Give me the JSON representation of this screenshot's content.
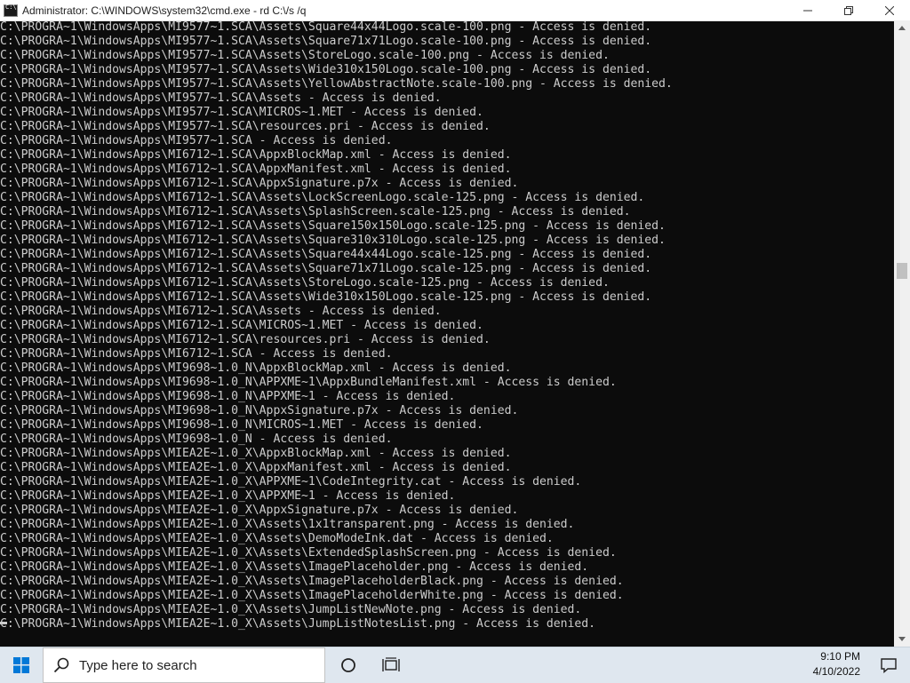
{
  "window": {
    "title": "Administrator: C:\\WINDOWS\\system32\\cmd.exe - rd  C:\\/s /q",
    "controls": {
      "minimize_icon": "minimize-icon",
      "maximize_icon": "restore-icon",
      "close_icon": "close-icon"
    }
  },
  "console": {
    "background": "#0c0c0c",
    "foreground": "#cccccc",
    "lines": [
      "C:\\PROGRA~1\\WindowsApps\\MI9577~1.SCA\\Assets\\Square44x44Logo.scale-100.png - Access is denied.",
      "C:\\PROGRA~1\\WindowsApps\\MI9577~1.SCA\\Assets\\Square71x71Logo.scale-100.png - Access is denied.",
      "C:\\PROGRA~1\\WindowsApps\\MI9577~1.SCA\\Assets\\StoreLogo.scale-100.png - Access is denied.",
      "C:\\PROGRA~1\\WindowsApps\\MI9577~1.SCA\\Assets\\Wide310x150Logo.scale-100.png - Access is denied.",
      "C:\\PROGRA~1\\WindowsApps\\MI9577~1.SCA\\Assets\\YellowAbstractNote.scale-100.png - Access is denied.",
      "C:\\PROGRA~1\\WindowsApps\\MI9577~1.SCA\\Assets - Access is denied.",
      "C:\\PROGRA~1\\WindowsApps\\MI9577~1.SCA\\MICROS~1.MET - Access is denied.",
      "C:\\PROGRA~1\\WindowsApps\\MI9577~1.SCA\\resources.pri - Access is denied.",
      "C:\\PROGRA~1\\WindowsApps\\MI9577~1.SCA - Access is denied.",
      "C:\\PROGRA~1\\WindowsApps\\MI6712~1.SCA\\AppxBlockMap.xml - Access is denied.",
      "C:\\PROGRA~1\\WindowsApps\\MI6712~1.SCA\\AppxManifest.xml - Access is denied.",
      "C:\\PROGRA~1\\WindowsApps\\MI6712~1.SCA\\AppxSignature.p7x - Access is denied.",
      "C:\\PROGRA~1\\WindowsApps\\MI6712~1.SCA\\Assets\\LockScreenLogo.scale-125.png - Access is denied.",
      "C:\\PROGRA~1\\WindowsApps\\MI6712~1.SCA\\Assets\\SplashScreen.scale-125.png - Access is denied.",
      "C:\\PROGRA~1\\WindowsApps\\MI6712~1.SCA\\Assets\\Square150x150Logo.scale-125.png - Access is denied.",
      "C:\\PROGRA~1\\WindowsApps\\MI6712~1.SCA\\Assets\\Square310x310Logo.scale-125.png - Access is denied.",
      "C:\\PROGRA~1\\WindowsApps\\MI6712~1.SCA\\Assets\\Square44x44Logo.scale-125.png - Access is denied.",
      "C:\\PROGRA~1\\WindowsApps\\MI6712~1.SCA\\Assets\\Square71x71Logo.scale-125.png - Access is denied.",
      "C:\\PROGRA~1\\WindowsApps\\MI6712~1.SCA\\Assets\\StoreLogo.scale-125.png - Access is denied.",
      "C:\\PROGRA~1\\WindowsApps\\MI6712~1.SCA\\Assets\\Wide310x150Logo.scale-125.png - Access is denied.",
      "C:\\PROGRA~1\\WindowsApps\\MI6712~1.SCA\\Assets - Access is denied.",
      "C:\\PROGRA~1\\WindowsApps\\MI6712~1.SCA\\MICROS~1.MET - Access is denied.",
      "C:\\PROGRA~1\\WindowsApps\\MI6712~1.SCA\\resources.pri - Access is denied.",
      "C:\\PROGRA~1\\WindowsApps\\MI6712~1.SCA - Access is denied.",
      "C:\\PROGRA~1\\WindowsApps\\MI9698~1.0_N\\AppxBlockMap.xml - Access is denied.",
      "C:\\PROGRA~1\\WindowsApps\\MI9698~1.0_N\\APPXME~1\\AppxBundleManifest.xml - Access is denied.",
      "C:\\PROGRA~1\\WindowsApps\\MI9698~1.0_N\\APPXME~1 - Access is denied.",
      "C:\\PROGRA~1\\WindowsApps\\MI9698~1.0_N\\AppxSignature.p7x - Access is denied.",
      "C:\\PROGRA~1\\WindowsApps\\MI9698~1.0_N\\MICROS~1.MET - Access is denied.",
      "C:\\PROGRA~1\\WindowsApps\\MI9698~1.0_N - Access is denied.",
      "C:\\PROGRA~1\\WindowsApps\\MIEA2E~1.0_X\\AppxBlockMap.xml - Access is denied.",
      "C:\\PROGRA~1\\WindowsApps\\MIEA2E~1.0_X\\AppxManifest.xml - Access is denied.",
      "C:\\PROGRA~1\\WindowsApps\\MIEA2E~1.0_X\\APPXME~1\\CodeIntegrity.cat - Access is denied.",
      "C:\\PROGRA~1\\WindowsApps\\MIEA2E~1.0_X\\APPXME~1 - Access is denied.",
      "C:\\PROGRA~1\\WindowsApps\\MIEA2E~1.0_X\\AppxSignature.p7x - Access is denied.",
      "C:\\PROGRA~1\\WindowsApps\\MIEA2E~1.0_X\\Assets\\1x1transparent.png - Access is denied.",
      "C:\\PROGRA~1\\WindowsApps\\MIEA2E~1.0_X\\Assets\\DemoModeInk.dat - Access is denied.",
      "C:\\PROGRA~1\\WindowsApps\\MIEA2E~1.0_X\\Assets\\ExtendedSplashScreen.png - Access is denied.",
      "C:\\PROGRA~1\\WindowsApps\\MIEA2E~1.0_X\\Assets\\ImagePlaceholder.png - Access is denied.",
      "C:\\PROGRA~1\\WindowsApps\\MIEA2E~1.0_X\\Assets\\ImagePlaceholderBlack.png - Access is denied.",
      "C:\\PROGRA~1\\WindowsApps\\MIEA2E~1.0_X\\Assets\\ImagePlaceholderWhite.png - Access is denied.",
      "C:\\PROGRA~1\\WindowsApps\\MIEA2E~1.0_X\\Assets\\JumpListNewNote.png - Access is denied.",
      "C:\\PROGRA~1\\WindowsApps\\MIEA2E~1.0_X\\Assets\\JumpListNotesList.png - Access is denied."
    ]
  },
  "taskbar": {
    "search_placeholder": "Type here to search",
    "time": "9:10 PM",
    "date": "4/10/2022",
    "icons": [
      "windows-start-icon",
      "search-icon",
      "cortana-icon",
      "task-view-icon",
      "notification-icon"
    ]
  }
}
